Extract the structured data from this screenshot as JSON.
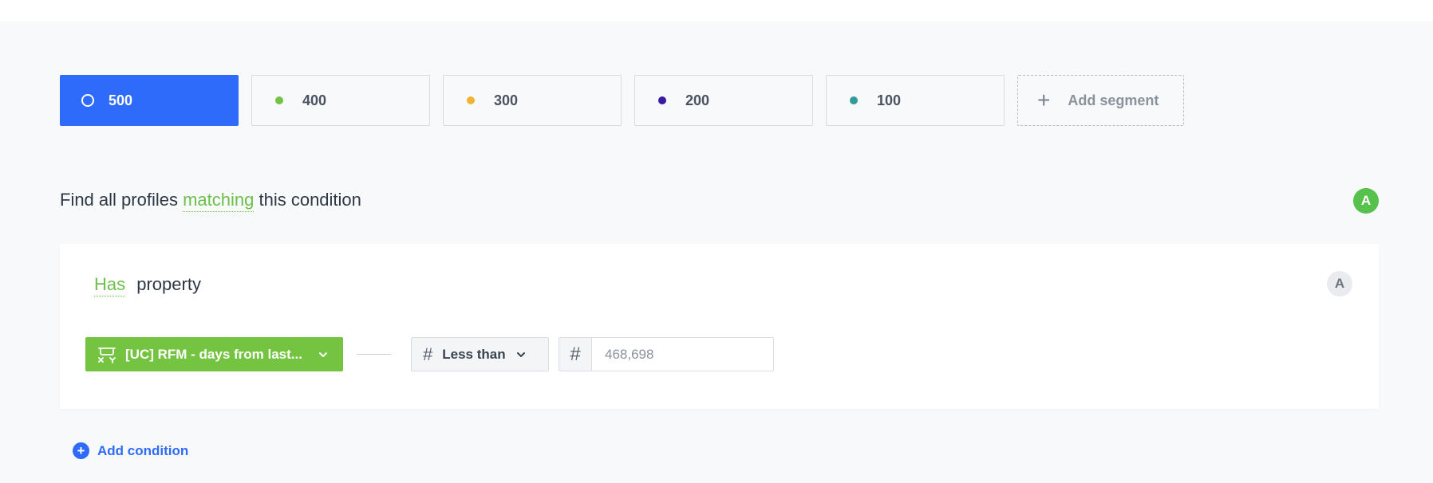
{
  "segments": [
    {
      "label": "500",
      "active": true,
      "dot_color": "#ffffff"
    },
    {
      "label": "400",
      "active": false,
      "dot_color": "#73c446"
    },
    {
      "label": "300",
      "active": false,
      "dot_color": "#f2b333"
    },
    {
      "label": "200",
      "active": false,
      "dot_color": "#3b1aa3"
    },
    {
      "label": "100",
      "active": false,
      "dot_color": "#2f9c9a"
    }
  ],
  "add_segment_label": "Add segment",
  "condition_header": {
    "prefix": "Find all profiles",
    "highlight": "matching",
    "suffix": "this condition",
    "badge": "A"
  },
  "card": {
    "title_highlight": "Has",
    "title_rest": "property",
    "badge": "A",
    "property_label": "[UC] RFM - days from last...",
    "operator_icon": "#",
    "operator_label": "Less than",
    "value_icon": "#",
    "value": "468,698"
  },
  "add_condition_label": "Add condition",
  "colors": {
    "accent_blue": "#2e6bfa",
    "brand_green": "#74c441",
    "badge_green": "#57c24b"
  }
}
